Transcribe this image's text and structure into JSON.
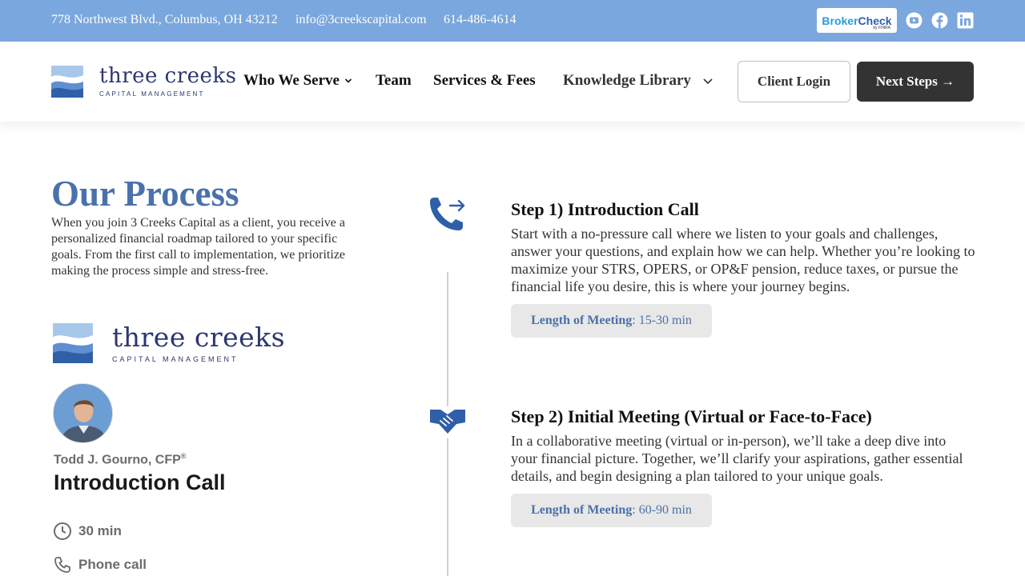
{
  "topbar": {
    "address": "778 Northwest Blvd., Columbus, OH 43212",
    "email": "info@3creekscapital.com",
    "phone": "614-486-4614",
    "brokercheck_a": "Broker",
    "brokercheck_b": "Check",
    "brokercheck_sub": "by FINRA"
  },
  "nav": {
    "logo_name": "three creeks",
    "logo_sub": "CAPITAL MANAGEMENT",
    "items": [
      {
        "label": "Who We Serve"
      },
      {
        "label": "Team"
      },
      {
        "label": "Services & Fees"
      },
      {
        "label": "Knowledge Library"
      }
    ],
    "client_login": "Client Login",
    "next_steps": "Next Steps →"
  },
  "colors": {
    "topbar": "#7aa7dd",
    "accent": "#4a71ab",
    "dark_button": "#333333",
    "icon_blue": "#2f5fa8"
  },
  "main": {
    "title": "Our Process",
    "intro": "When you join 3 Creeks Capital as a client, you receive a personalized financial roadmap tailored to your specific goals. From the first call to implementation, we prioritize making the process simple and stress-free."
  },
  "booking_card": {
    "logo_name": "three creeks",
    "logo_sub": "CAPITAL MANAGEMENT",
    "person": "Todd J. Gourno, CFP",
    "person_mark": "®",
    "title": "Introduction Call",
    "duration": "30 min",
    "method": "Phone call"
  },
  "steps": [
    {
      "icon": "phone-forward-icon",
      "title": "Step 1) Introduction Call",
      "description": "Start with a no-pressure call where we listen to your goals and challenges, answer your questions, and explain how we can help. Whether you’re looking to maximize your STRS, OPERS, or OP&F pension, reduce taxes, or pursue the financial life you desire, this is where your journey begins.",
      "length_label": "Length of Meeting",
      "length_value": ": 15-30 min"
    },
    {
      "icon": "handshake-icon",
      "title": "Step 2) Initial Meeting (Virtual or Face-to-Face)",
      "description": "In a collaborative meeting (virtual or in-person), we’ll take a deep dive into your financial picture. Together, we’ll clarify your aspirations, gather essential details, and begin designing a plan tailored to your unique goals.",
      "length_label": "Length of Meeting",
      "length_value": ": 60-90 min"
    }
  ]
}
